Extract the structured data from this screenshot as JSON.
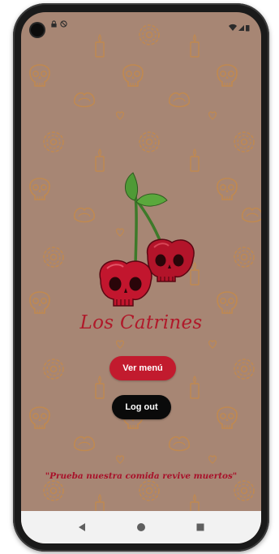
{
  "app": {
    "brand_name": "Los Catrines",
    "tagline": "\"Prueba nuestra comida revive muertos\""
  },
  "buttons": {
    "menu_label": "Ver menú",
    "logout_label": "Log out"
  },
  "colors": {
    "background": "#a78674",
    "pattern_stroke": "#c58a4a",
    "brand_red": "#c21b2e",
    "logout_black": "#0a0a0a",
    "nav_bar": "#f2f2f2"
  },
  "icons": {
    "logo": "cherry-skulls-icon",
    "nav_back": "back-triangle-icon",
    "nav_home": "home-circle-icon",
    "nav_recents": "recents-square-icon"
  }
}
